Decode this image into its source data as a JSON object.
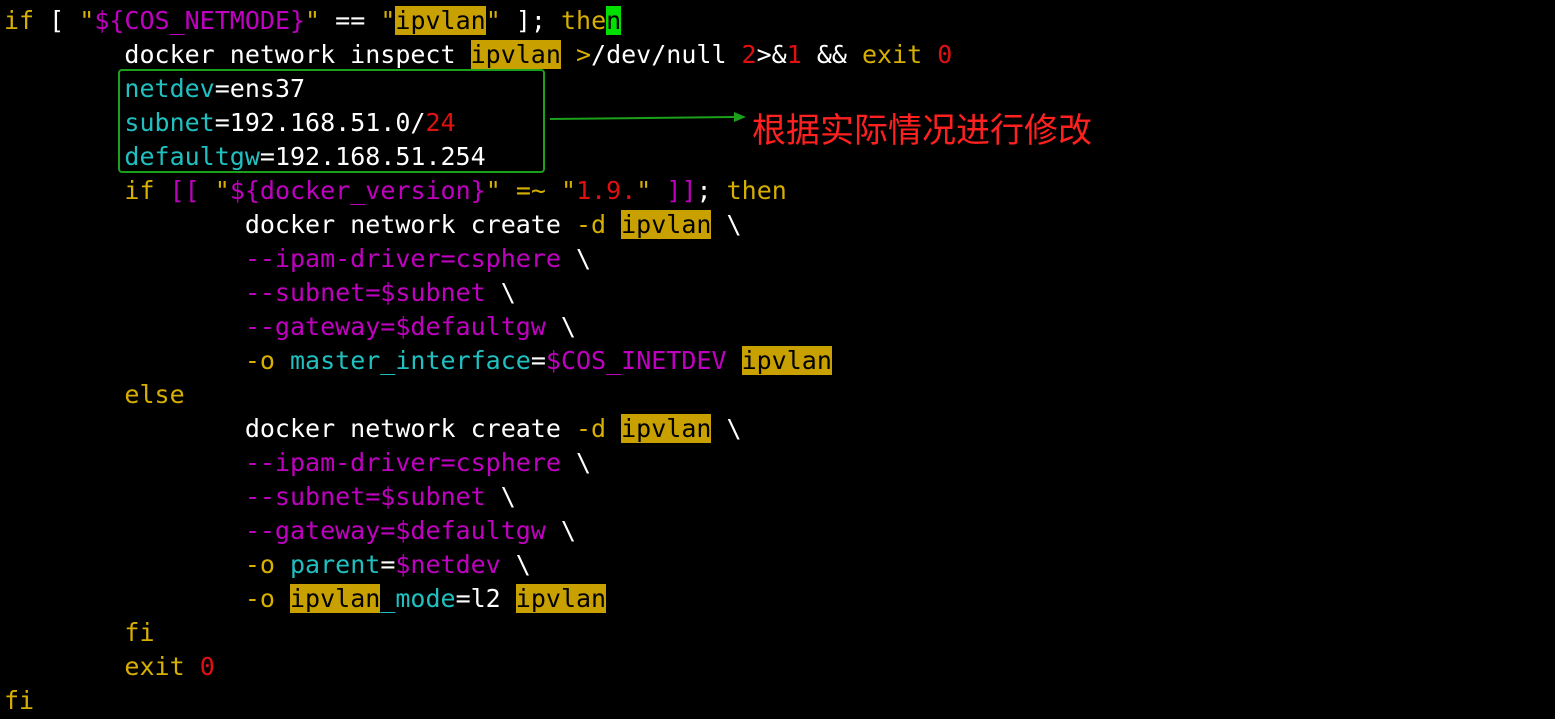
{
  "terminal": {
    "lines": [
      [
        [
          "kw",
          "if"
        ],
        [
          "plain",
          " [ "
        ],
        [
          "str",
          "\""
        ],
        [
          "var",
          "${COS_NETMODE}"
        ],
        [
          "str",
          "\""
        ],
        [
          "plain",
          " == "
        ],
        [
          "str",
          "\""
        ],
        [
          "hl",
          "ipvlan"
        ],
        [
          "str",
          "\""
        ],
        [
          "plain",
          " ]; "
        ],
        [
          "kw",
          "the"
        ],
        [
          "cursor",
          "n"
        ]
      ],
      [
        [
          "plain",
          "        docker network inspect "
        ],
        [
          "hl",
          "ipvlan"
        ],
        [
          "plain",
          " "
        ],
        [
          "str",
          ">"
        ],
        [
          "plain",
          "/dev/null "
        ],
        [
          "num",
          "2"
        ],
        [
          "plain",
          ">&"
        ],
        [
          "num",
          "1"
        ],
        [
          "plain",
          " && "
        ],
        [
          "kw",
          "exit"
        ],
        [
          "plain",
          " "
        ],
        [
          "num",
          "0"
        ]
      ],
      [
        [
          "plain",
          "        "
        ],
        [
          "cyan",
          "netdev"
        ],
        [
          "plain",
          "=ens37"
        ]
      ],
      [
        [
          "plain",
          "        "
        ],
        [
          "cyan",
          "subnet"
        ],
        [
          "plain",
          "=192.168.51.0/"
        ],
        [
          "num",
          "24"
        ]
      ],
      [
        [
          "plain",
          "        "
        ],
        [
          "cyan",
          "defaultgw"
        ],
        [
          "plain",
          "=192.168.51.254"
        ]
      ],
      [
        [
          "plain",
          "        "
        ],
        [
          "kw",
          "if"
        ],
        [
          "plain",
          " "
        ],
        [
          "var",
          "[["
        ],
        [
          "plain",
          " "
        ],
        [
          "str",
          "\""
        ],
        [
          "var",
          "${docker_version}"
        ],
        [
          "str",
          "\""
        ],
        [
          "plain",
          " "
        ],
        [
          "kw",
          "=~"
        ],
        [
          "plain",
          " "
        ],
        [
          "str",
          "\""
        ],
        [
          "num",
          "1.9."
        ],
        [
          "str",
          "\""
        ],
        [
          "plain",
          " "
        ],
        [
          "var",
          "]]"
        ],
        [
          "plain",
          "; "
        ],
        [
          "kw",
          "then"
        ]
      ],
      [
        [
          "plain",
          "                docker network create "
        ],
        [
          "kw",
          "-d"
        ],
        [
          "plain",
          " "
        ],
        [
          "hl",
          "ipvlan"
        ],
        [
          "plain",
          " \\"
        ]
      ],
      [
        [
          "plain",
          "                "
        ],
        [
          "opt",
          "--ipam-driver=csphere"
        ],
        [
          "plain",
          " \\"
        ]
      ],
      [
        [
          "plain",
          "                "
        ],
        [
          "opt",
          "--subnet=$subnet"
        ],
        [
          "plain",
          " \\"
        ]
      ],
      [
        [
          "plain",
          "                "
        ],
        [
          "opt",
          "--gateway=$defaultgw"
        ],
        [
          "plain",
          " \\"
        ]
      ],
      [
        [
          "plain",
          "                "
        ],
        [
          "kw",
          "-o"
        ],
        [
          "plain",
          " "
        ],
        [
          "cyan",
          "master_interface"
        ],
        [
          "plain",
          "="
        ],
        [
          "var",
          "$COS_INETDEV"
        ],
        [
          "plain",
          " "
        ],
        [
          "hl",
          "ipvlan"
        ]
      ],
      [
        [
          "plain",
          "        "
        ],
        [
          "kw",
          "else"
        ]
      ],
      [
        [
          "plain",
          "                docker network create "
        ],
        [
          "kw",
          "-d"
        ],
        [
          "plain",
          " "
        ],
        [
          "hl",
          "ipvlan"
        ],
        [
          "plain",
          " \\"
        ]
      ],
      [
        [
          "plain",
          "                "
        ],
        [
          "opt",
          "--ipam-driver=csphere"
        ],
        [
          "plain",
          " \\"
        ]
      ],
      [
        [
          "plain",
          "                "
        ],
        [
          "opt",
          "--subnet=$subnet"
        ],
        [
          "plain",
          " \\"
        ]
      ],
      [
        [
          "plain",
          "                "
        ],
        [
          "opt",
          "--gateway=$defaultgw"
        ],
        [
          "plain",
          " \\"
        ]
      ],
      [
        [
          "plain",
          "                "
        ],
        [
          "kw",
          "-o"
        ],
        [
          "plain",
          " "
        ],
        [
          "cyan",
          "parent"
        ],
        [
          "plain",
          "="
        ],
        [
          "var",
          "$netdev"
        ],
        [
          "plain",
          " \\"
        ]
      ],
      [
        [
          "plain",
          "                "
        ],
        [
          "kw",
          "-o"
        ],
        [
          "plain",
          " "
        ],
        [
          "hl",
          "ipvlan"
        ],
        [
          "cyan",
          "_mode"
        ],
        [
          "plain",
          "=l2 "
        ],
        [
          "hl",
          "ipvlan"
        ]
      ],
      [
        [
          "plain",
          "        "
        ],
        [
          "kw",
          "fi"
        ]
      ],
      [
        [
          "plain",
          "        "
        ],
        [
          "kw",
          "exit"
        ],
        [
          "plain",
          " "
        ],
        [
          "num",
          "0"
        ]
      ],
      [
        [
          "kw",
          "fi"
        ]
      ]
    ]
  },
  "annotation": {
    "text": "根据实际情况进行修改",
    "box_color": "#1aa01a",
    "text_color": "#ff2020"
  },
  "colors": {
    "background": "#000000",
    "keyword": "#d7af00",
    "variable": "#c000c0",
    "number": "#e01010",
    "identifier": "#20c0c0",
    "search_highlight": "#c8a000",
    "cursor": "#00e000"
  }
}
